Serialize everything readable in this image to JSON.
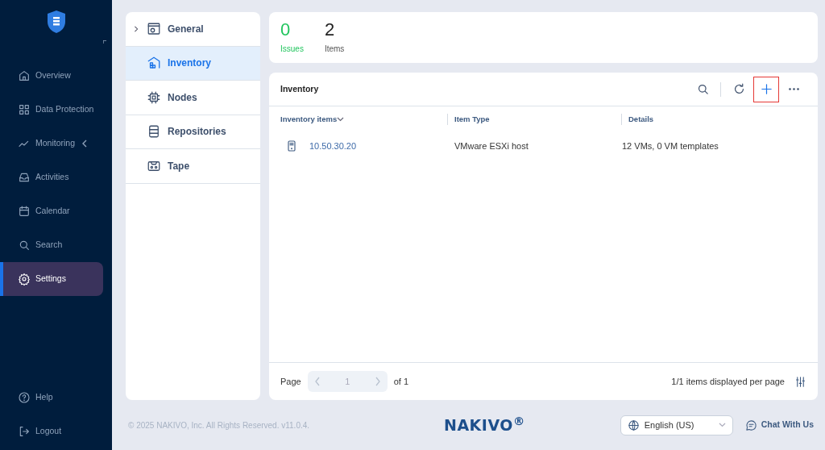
{
  "sidebar": {
    "items": [
      {
        "label": "Overview",
        "selected": false,
        "has_submenu": false
      },
      {
        "label": "Data Protection",
        "selected": false,
        "has_submenu": false
      },
      {
        "label": "Monitoring",
        "selected": false,
        "has_submenu": true
      },
      {
        "label": "Activities",
        "selected": false,
        "has_submenu": false
      },
      {
        "label": "Calendar",
        "selected": false,
        "has_submenu": false
      },
      {
        "label": "Search",
        "selected": false,
        "has_submenu": false
      },
      {
        "label": "Settings",
        "selected": true,
        "has_submenu": false
      }
    ],
    "bottom_items": [
      {
        "label": "Help"
      },
      {
        "label": "Logout"
      }
    ]
  },
  "settings_nav": {
    "items": [
      {
        "label": "General",
        "selected": false,
        "expandable": true
      },
      {
        "label": "Inventory",
        "selected": true,
        "expandable": false
      },
      {
        "label": "Nodes",
        "selected": false,
        "expandable": false
      },
      {
        "label": "Repositories",
        "selected": false,
        "expandable": false
      },
      {
        "label": "Tape",
        "selected": false,
        "expandable": false
      }
    ]
  },
  "summary": [
    {
      "value": "0",
      "label": "Issues",
      "color": "#22c55e"
    },
    {
      "value": "2",
      "label": "Items",
      "color": "#222222"
    }
  ],
  "inventory": {
    "title": "Inventory",
    "toolbar": [
      {
        "kind": "search",
        "highlighted": false
      },
      {
        "kind": "refresh",
        "highlighted": false
      },
      {
        "kind": "add",
        "highlighted": true
      },
      {
        "kind": "more",
        "highlighted": false
      }
    ],
    "columns": [
      "Inventory items",
      "Item Type",
      "Details"
    ],
    "rows": [
      {
        "name": "10.50.30.20",
        "type": "VMware ESXi host",
        "details": "12 VMs, 0 VM templates"
      }
    ],
    "pagination": {
      "label": "Page",
      "page": "1",
      "of": "of 1",
      "per_page": "1/1 items displayed per page"
    }
  },
  "footer": {
    "copyright": "© 2025 NAKIVO, Inc. All Rights Reserved. v11.0.4.",
    "logo": "NAKIVO$^{®}$",
    "language": "English (US)",
    "chat": "Chat With Us"
  }
}
